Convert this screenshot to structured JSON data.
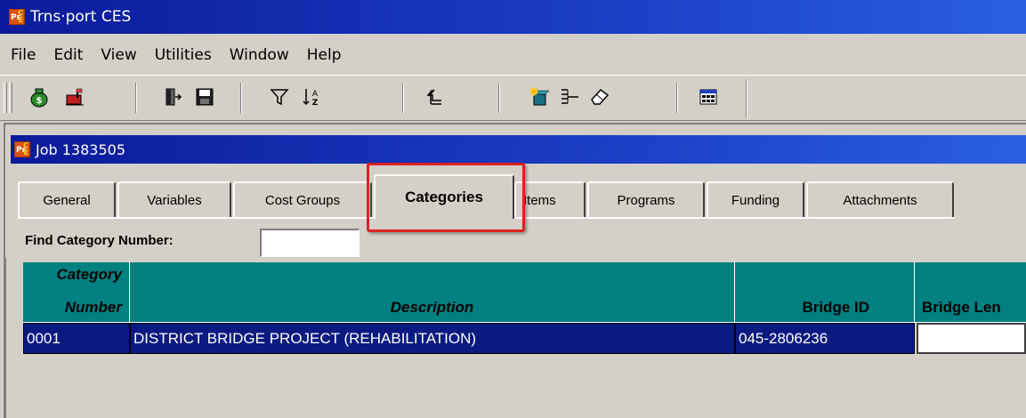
{
  "app": {
    "title": "Trns·port CES",
    "icon": "pr-ce-logo-icon"
  },
  "menu": {
    "items": [
      "File",
      "Edit",
      "View",
      "Utilities",
      "Window",
      "Help"
    ]
  },
  "toolbar": {
    "buttons": [
      {
        "name": "money-bag-icon"
      },
      {
        "name": "mailbox-icon"
      },
      {
        "name": "exit-door-icon"
      },
      {
        "name": "save-disk-icon"
      },
      {
        "name": "filter-icon"
      },
      {
        "name": "sort-az-icon"
      },
      {
        "name": "back-arrow-icon"
      },
      {
        "name": "new-item-icon"
      },
      {
        "name": "list-tree-icon"
      },
      {
        "name": "eraser-icon"
      },
      {
        "name": "calculator-window-icon"
      }
    ]
  },
  "child": {
    "title": "Job 1383505"
  },
  "tabs": [
    {
      "label": "General"
    },
    {
      "label": "Variables"
    },
    {
      "label": "Cost Groups"
    },
    {
      "label": "Categories",
      "active": true
    },
    {
      "label": "Items"
    },
    {
      "label": "Programs"
    },
    {
      "label": "Funding"
    },
    {
      "label": "Attachments"
    }
  ],
  "find": {
    "label": "Find Category Number:",
    "value": ""
  },
  "grid": {
    "headers": {
      "category_number_line1": "Category",
      "category_number_line2": "Number",
      "description": "Description",
      "bridge_id": "Bridge ID",
      "bridge_length": "Bridge Len"
    },
    "rows": [
      {
        "category_number": "0001",
        "description": "DISTRICT BRIDGE PROJECT (REHABILITATION)",
        "bridge_id": "045-2806236",
        "bridge_length": ""
      }
    ]
  },
  "colors": {
    "titlebar": "#0a1a9a",
    "header_teal": "#008080",
    "selected_row": "#0a1a80",
    "highlight_red": "#e02020"
  }
}
